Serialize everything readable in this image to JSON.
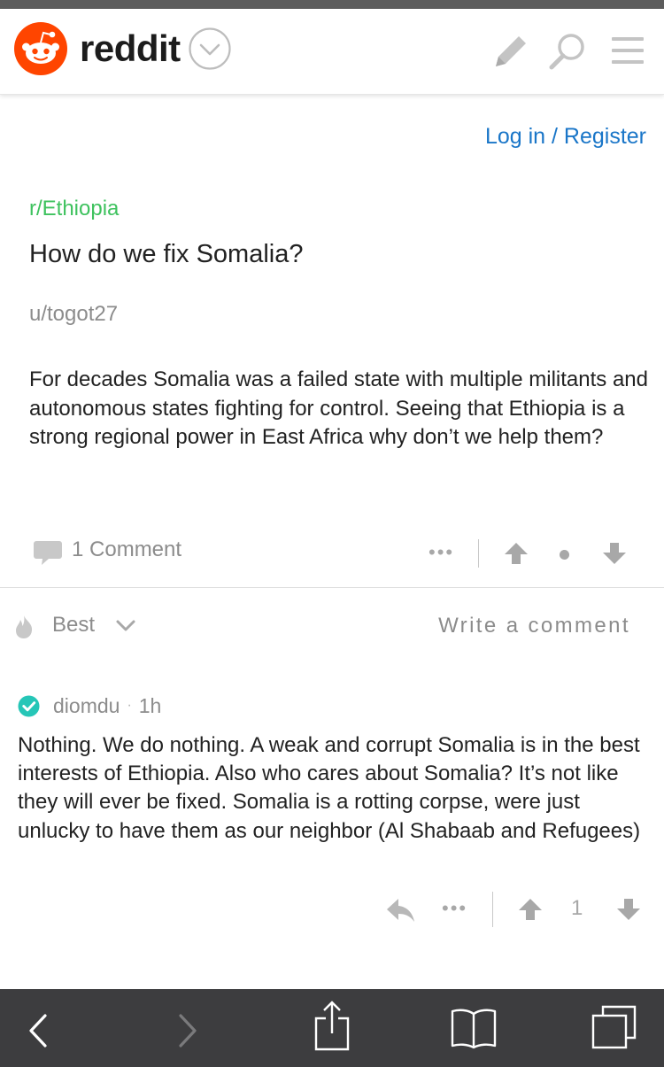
{
  "header": {
    "brand": "reddit",
    "icons": [
      "snoo-logo",
      "chevron-down-circle-icon",
      "pencil-icon",
      "search-icon",
      "hamburger-menu-icon"
    ]
  },
  "auth": {
    "login_label": "Log in / Register"
  },
  "post": {
    "subreddit": "r/Ethiopia",
    "title": "How do we fix Somalia?",
    "author": "u/togot27",
    "body": "For decades Somalia was a failed state with multiple militants and autonomous states fighting for control. Seeing that Ethiopia is a strong regional power in East Africa why don’t we help them?",
    "comment_count_label": "1 Comment",
    "more_label": "•••"
  },
  "sort": {
    "label": "Best",
    "write_comment": "Write a comment"
  },
  "comment": {
    "user": "diomdu",
    "separator": "·",
    "time": "1h",
    "body": "Nothing. We do nothing. A weak and corrupt Somalia is in the best interests of Ethiopia. Also who cares about Somalia? It’s not like they will ever be fixed. Somalia is a rotting corpse, were just unlucky to have them as our neighbor (Al Shabaab and Refugees)",
    "score": "1",
    "more_label": "•••"
  },
  "colors": {
    "reddit_orange": "#ff4500",
    "link_blue": "#1a76c8",
    "subreddit_green": "#3ec25e",
    "muted_gray": "#8c8c8c",
    "verified_teal": "#26c6b7",
    "toolbar_dark": "#3d3d3f"
  },
  "browser_toolbar": {
    "icons": [
      "back-icon",
      "forward-icon",
      "share-icon",
      "bookmarks-icon",
      "tabs-icon"
    ]
  }
}
